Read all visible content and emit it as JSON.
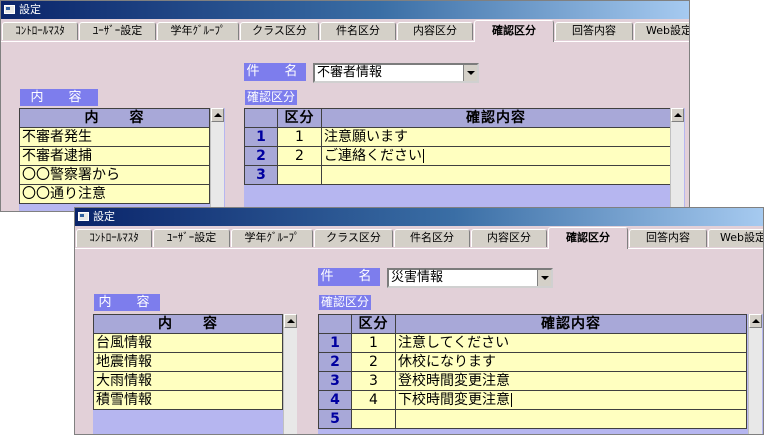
{
  "window1": {
    "title": "設定",
    "tabs": [
      "ｺﾝﾄﾛｰﾙﾏｽﾀ",
      "ﾕｰｻﾞｰ設定",
      "学年ｸﾞﾙｰﾌﾟ",
      "クラス区分",
      "件名区分",
      "内容区分",
      "確認区分",
      "回答内容",
      "Web設定"
    ],
    "active_tab": "確認区分",
    "subject_label": "件　名",
    "subject_value": "不審者情報",
    "content_label": "内　容",
    "content_header": "内　　容",
    "content_items": [
      "不審者発生",
      "不審者逮捕",
      "〇〇警察署から",
      "〇〇通り注意"
    ],
    "confirm_label": "確認区分",
    "confirm_headers": [
      "区分",
      "確認内容"
    ],
    "confirm_rows": [
      {
        "num": "1",
        "kubun": "1",
        "text": "注意願います"
      },
      {
        "num": "2",
        "kubun": "2",
        "text": "ご連絡ください"
      },
      {
        "num": "3",
        "kubun": "",
        "text": ""
      }
    ]
  },
  "window2": {
    "title": "設定",
    "tabs": [
      "ｺﾝﾄﾛｰﾙﾏｽﾀ",
      "ﾕｰｻﾞｰ設定",
      "学年ｸﾞﾙｰﾌﾟ",
      "クラス区分",
      "件名区分",
      "内容区分",
      "確認区分",
      "回答内容",
      "Web設定"
    ],
    "active_tab": "確認区分",
    "subject_label": "件　名",
    "subject_value": "災害情報",
    "content_label": "内　容",
    "content_header": "内　　容",
    "content_items": [
      "台風情報",
      "地震情報",
      "大雨情報",
      "積雪情報"
    ],
    "confirm_label": "確認区分",
    "confirm_headers": [
      "区分",
      "確認内容"
    ],
    "confirm_rows": [
      {
        "num": "1",
        "kubun": "1",
        "text": "注意してください"
      },
      {
        "num": "2",
        "kubun": "2",
        "text": "休校になります"
      },
      {
        "num": "3",
        "kubun": "3",
        "text": "登校時間変更注意"
      },
      {
        "num": "4",
        "kubun": "4",
        "text": "下校時間変更注意"
      },
      {
        "num": "5",
        "kubun": "",
        "text": ""
      }
    ]
  }
}
